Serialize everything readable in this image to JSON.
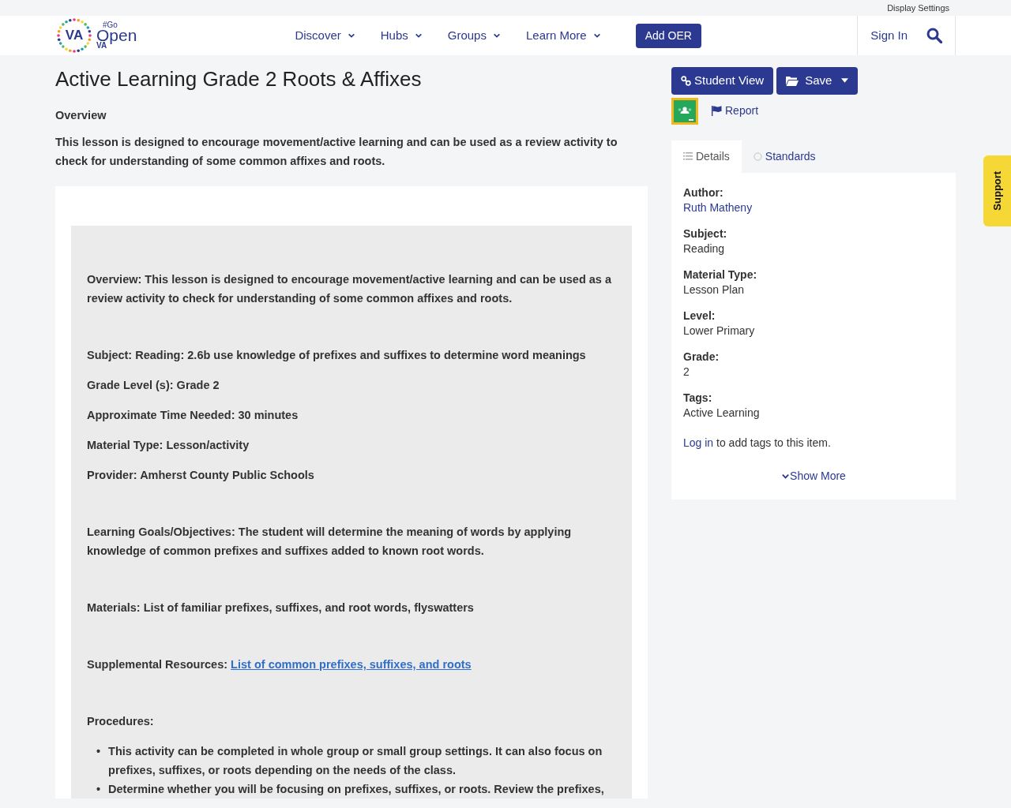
{
  "top_bar": {
    "display_settings": "Display Settings"
  },
  "logo": {
    "mark": "VA",
    "hashtag": "#Go",
    "word": "Open",
    "state": "VA"
  },
  "nav": [
    {
      "label": "Discover"
    },
    {
      "label": "Hubs"
    },
    {
      "label": "Groups"
    },
    {
      "label": "Learn More"
    }
  ],
  "add_button": "Add OER",
  "sign_in": "Sign In",
  "title": "Active Learning Grade 2 Roots & Affixes",
  "overview": {
    "heading": "Overview",
    "text": "This lesson is designed to encourage movement/active learning and can be used as a review activity to check for understanding of some common affixes and roots."
  },
  "content": [
    {
      "kind": "line",
      "text": "Overview:  This lesson is designed to encourage movement/active learning and can be used as a review activity to check for understanding of some common affixes and roots."
    },
    {
      "kind": "paragraph",
      "text": "Subject: Reading:  2.6b use knowledge of prefixes and suffixes to determine word meanings"
    },
    {
      "kind": "line",
      "text": "Grade Level (s):  Grade 2"
    },
    {
      "kind": "line",
      "text": "Approximate Time Needed: 30 minutes"
    },
    {
      "kind": "line",
      "text": "Material Type: Lesson/activity"
    },
    {
      "kind": "line",
      "text": "Provider: Amherst County Public Schools"
    },
    {
      "kind": "paragraph",
      "text": "Learning Goals/Objectives: The student will determine the meaning of words by applying knowledge of common prefixes and suffixes added to known root words."
    },
    {
      "kind": "paragraph",
      "text": "Materials: List of familiar prefixes, suffixes, and root words, flyswatters"
    },
    {
      "kind": "link_paragraph",
      "text": "Supplemental Resources:",
      "link": "List of common prefixes, suffixes, and roots"
    },
    {
      "kind": "paragraph",
      "text": "Procedures:"
    },
    {
      "kind": "bullets",
      "items": [
        {
          "marker": "•",
          "text": "This activity can be completed in whole group or small group settings. It can also focus on prefixes, suffixes, or roots depending on the needs of the class."
        },
        {
          "marker": "•",
          "text": "Determine whether you will be focusing on prefixes, suffixes, or roots. Review the prefixes,"
        }
      ]
    }
  ],
  "actions": {
    "student_view": "Student View",
    "save": "Save",
    "report": "Report"
  },
  "tabs": [
    {
      "label": "Details",
      "selected": true
    },
    {
      "label": "Standards",
      "selected": false
    }
  ],
  "details": [
    {
      "label": "Author:",
      "value": "Ruth Matheny",
      "kind": "link"
    },
    {
      "label": "Subject:",
      "value": "Reading",
      "kind": "text"
    },
    {
      "label": "Material Type:",
      "value": "Lesson Plan",
      "kind": "text"
    },
    {
      "label": "Level:",
      "value": "Lower Primary",
      "kind": "text"
    },
    {
      "label": "Grade:",
      "value": "2",
      "kind": "text"
    },
    {
      "label": "Tags:",
      "value": "Active Learning",
      "kind": "text"
    }
  ],
  "tags_note": {
    "link": "Log in",
    "text": "to add tags to this item."
  },
  "show_more": "Show More",
  "support": "Support"
}
